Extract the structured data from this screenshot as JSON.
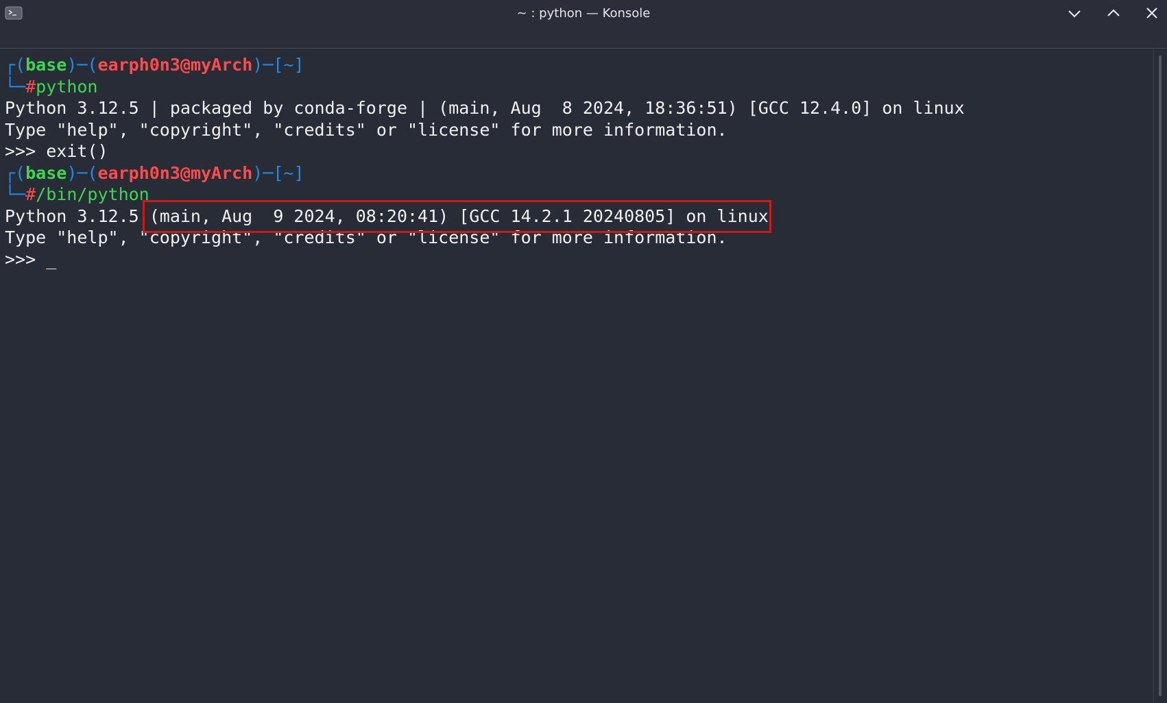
{
  "window": {
    "title": "~ : python — Konsole",
    "icon": "terminal-icon",
    "controls": [
      "chevron-down-icon",
      "chevron-up-icon",
      "close-icon"
    ]
  },
  "colors": {
    "background": "#282c37",
    "prompt_bracket": "#1f8be8",
    "prompt_env": "#3cd74e",
    "prompt_user": "#ff4b4b",
    "highlight": "#cc1a1a"
  },
  "terminal": {
    "prompt1": {
      "top_open": "┌(",
      "env": "base",
      "sep1": ")─(",
      "user": "earph0n3@myArch",
      "sep2": ")─[",
      "dir": "~",
      "close": "]",
      "corner": "└─",
      "hash": "#",
      "command": "python"
    },
    "output1_line1": "Python 3.12.5 | packaged by conda-forge | (main, Aug  8 2024, 18:36:51) [GCC 12.4.0] on linux",
    "output1_line2": "Type \"help\", \"copyright\", \"credits\" or \"license\" for more information.",
    "repl1": ">>> exit()",
    "prompt2": {
      "top_open": "┌(",
      "env": "base",
      "sep1": ")─(",
      "user": "earph0n3@myArch",
      "sep2": ")─[",
      "dir": "~",
      "close": "]",
      "corner": "└─",
      "hash": "#",
      "command": "/bin/python"
    },
    "output2_prefix": "Python 3.12.5 ",
    "output2_highlighted": "(main, Aug  9 2024, 08:20:41) [GCC 14.2.1 20240805] on linux",
    "output2_line2": "Type \"help\", \"copyright\", \"credits\" or \"license\" for more information.",
    "repl2_prompt": ">>> ",
    "cursor": "_"
  }
}
